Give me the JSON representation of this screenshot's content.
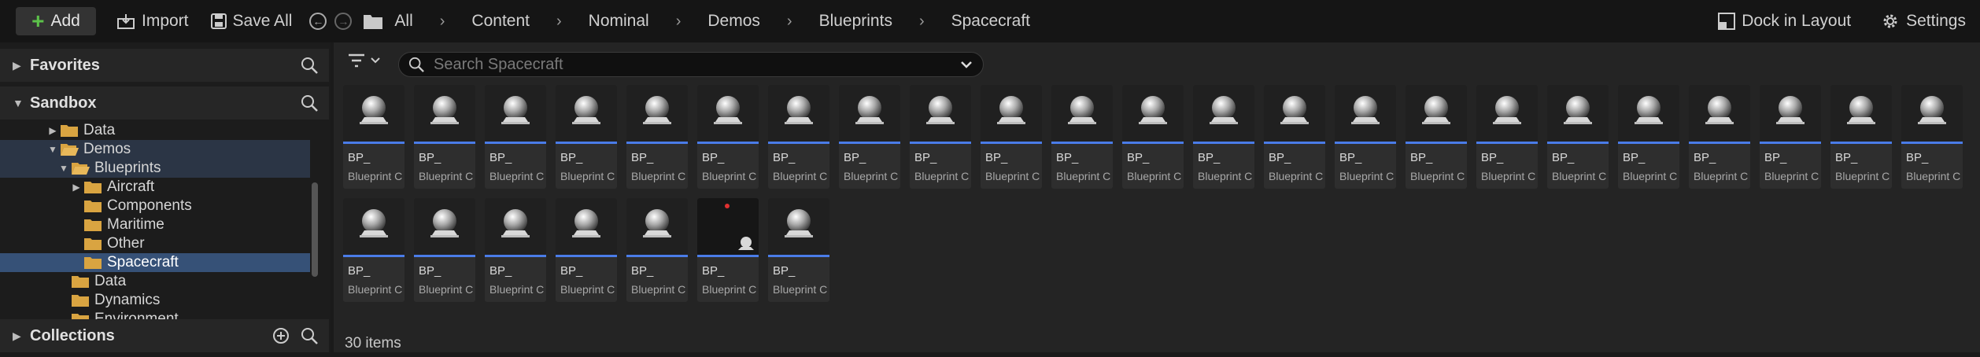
{
  "toolbar": {
    "add_label": "Add",
    "import_label": "Import",
    "save_all_label": "Save All",
    "breadcrumbs": [
      "All",
      "Content",
      "Nominal",
      "Demos",
      "Blueprints",
      "Spacecraft"
    ],
    "dock_label": "Dock in Layout",
    "settings_label": "Settings"
  },
  "left": {
    "favorites": "Favorites",
    "sandbox": "Sandbox",
    "collections": "Collections",
    "tree": [
      {
        "label": "Data"
      },
      {
        "label": "Demos"
      },
      {
        "label": "Blueprints"
      },
      {
        "label": "Aircraft"
      },
      {
        "label": "Components"
      },
      {
        "label": "Maritime"
      },
      {
        "label": "Other"
      },
      {
        "label": "Spacecraft"
      },
      {
        "label": "Data"
      },
      {
        "label": "Dynamics"
      },
      {
        "label": "Environment"
      }
    ]
  },
  "search": {
    "placeholder": "Search Spacecraft"
  },
  "asset": {
    "name": "BP_",
    "type": "Blueprint Class"
  },
  "status": {
    "item_count": "30 items"
  },
  "colors": {
    "accent": "#4a7ce8",
    "selection": "#365177",
    "add_plus": "#5cc24a"
  }
}
